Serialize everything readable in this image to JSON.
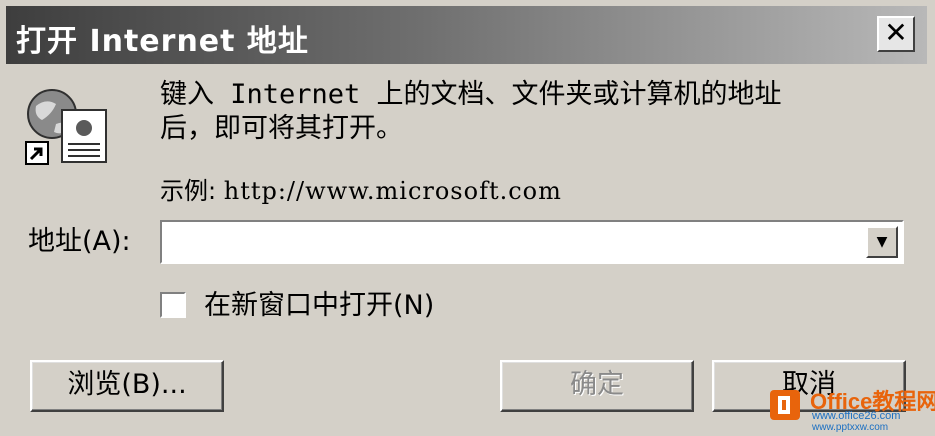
{
  "window": {
    "title": "打开 Internet 地址",
    "close_glyph": "✕",
    "icon": "internet-shortcut-icon"
  },
  "description": {
    "line1": "键入 Internet 上的文档、文件夹或计算机的地址",
    "line2": "后，即可将其打开。"
  },
  "example": {
    "label": "示例:",
    "url": "http://www.microsoft.com"
  },
  "address": {
    "label": "地址(A):",
    "value": "",
    "dropdown_icon": "▼"
  },
  "checkbox": {
    "label": "在新窗口中打开(N)",
    "checked": false
  },
  "buttons": {
    "browse": "浏览(B)...",
    "ok": "确定",
    "cancel": "取消"
  },
  "watermark": {
    "brand": "Office教程网",
    "url1": "www.office26.com",
    "url2": "www.pptxxw.com"
  },
  "colors": {
    "dialog_bg": "#d4d0c8",
    "title_gradient_start": "#3e3e3e",
    "title_gradient_end": "#b8b8b8",
    "watermark_orange": "#e8640c",
    "watermark_blue": "#1b6fc2"
  }
}
